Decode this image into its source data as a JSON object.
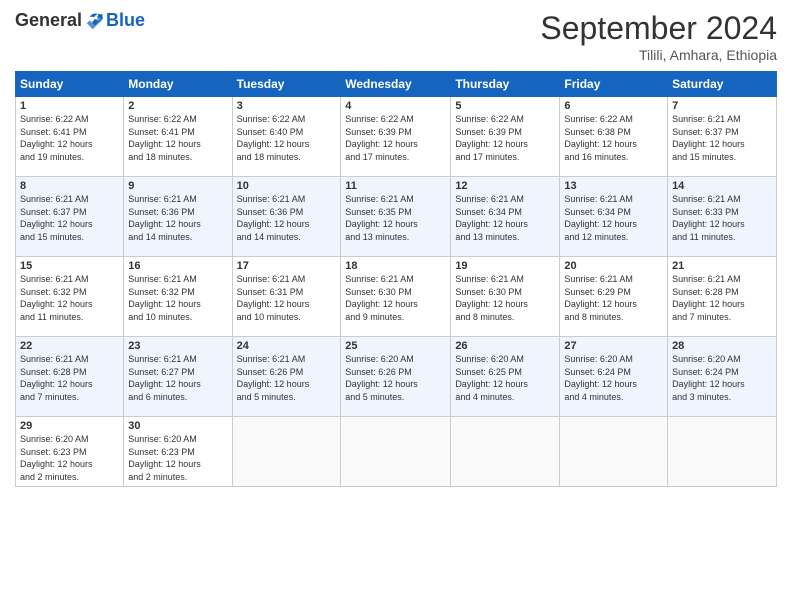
{
  "logo": {
    "general": "General",
    "blue": "Blue"
  },
  "header": {
    "month": "September 2024",
    "location": "Tilili, Amhara, Ethiopia"
  },
  "days_of_week": [
    "Sunday",
    "Monday",
    "Tuesday",
    "Wednesday",
    "Thursday",
    "Friday",
    "Saturday"
  ],
  "weeks": [
    [
      {
        "day": "1",
        "sunrise": "6:22 AM",
        "sunset": "6:41 PM",
        "daylight": "12 hours and 19 minutes."
      },
      {
        "day": "2",
        "sunrise": "6:22 AM",
        "sunset": "6:41 PM",
        "daylight": "12 hours and 18 minutes."
      },
      {
        "day": "3",
        "sunrise": "6:22 AM",
        "sunset": "6:40 PM",
        "daylight": "12 hours and 18 minutes."
      },
      {
        "day": "4",
        "sunrise": "6:22 AM",
        "sunset": "6:39 PM",
        "daylight": "12 hours and 17 minutes."
      },
      {
        "day": "5",
        "sunrise": "6:22 AM",
        "sunset": "6:39 PM",
        "daylight": "12 hours and 17 minutes."
      },
      {
        "day": "6",
        "sunrise": "6:22 AM",
        "sunset": "6:38 PM",
        "daylight": "12 hours and 16 minutes."
      },
      {
        "day": "7",
        "sunrise": "6:21 AM",
        "sunset": "6:37 PM",
        "daylight": "12 hours and 15 minutes."
      }
    ],
    [
      {
        "day": "8",
        "sunrise": "6:21 AM",
        "sunset": "6:37 PM",
        "daylight": "12 hours and 15 minutes."
      },
      {
        "day": "9",
        "sunrise": "6:21 AM",
        "sunset": "6:36 PM",
        "daylight": "12 hours and 14 minutes."
      },
      {
        "day": "10",
        "sunrise": "6:21 AM",
        "sunset": "6:36 PM",
        "daylight": "12 hours and 14 minutes."
      },
      {
        "day": "11",
        "sunrise": "6:21 AM",
        "sunset": "6:35 PM",
        "daylight": "12 hours and 13 minutes."
      },
      {
        "day": "12",
        "sunrise": "6:21 AM",
        "sunset": "6:34 PM",
        "daylight": "12 hours and 13 minutes."
      },
      {
        "day": "13",
        "sunrise": "6:21 AM",
        "sunset": "6:34 PM",
        "daylight": "12 hours and 12 minutes."
      },
      {
        "day": "14",
        "sunrise": "6:21 AM",
        "sunset": "6:33 PM",
        "daylight": "12 hours and 11 minutes."
      }
    ],
    [
      {
        "day": "15",
        "sunrise": "6:21 AM",
        "sunset": "6:32 PM",
        "daylight": "12 hours and 11 minutes."
      },
      {
        "day": "16",
        "sunrise": "6:21 AM",
        "sunset": "6:32 PM",
        "daylight": "12 hours and 10 minutes."
      },
      {
        "day": "17",
        "sunrise": "6:21 AM",
        "sunset": "6:31 PM",
        "daylight": "12 hours and 10 minutes."
      },
      {
        "day": "18",
        "sunrise": "6:21 AM",
        "sunset": "6:30 PM",
        "daylight": "12 hours and 9 minutes."
      },
      {
        "day": "19",
        "sunrise": "6:21 AM",
        "sunset": "6:30 PM",
        "daylight": "12 hours and 8 minutes."
      },
      {
        "day": "20",
        "sunrise": "6:21 AM",
        "sunset": "6:29 PM",
        "daylight": "12 hours and 8 minutes."
      },
      {
        "day": "21",
        "sunrise": "6:21 AM",
        "sunset": "6:28 PM",
        "daylight": "12 hours and 7 minutes."
      }
    ],
    [
      {
        "day": "22",
        "sunrise": "6:21 AM",
        "sunset": "6:28 PM",
        "daylight": "12 hours and 7 minutes."
      },
      {
        "day": "23",
        "sunrise": "6:21 AM",
        "sunset": "6:27 PM",
        "daylight": "12 hours and 6 minutes."
      },
      {
        "day": "24",
        "sunrise": "6:21 AM",
        "sunset": "6:26 PM",
        "daylight": "12 hours and 5 minutes."
      },
      {
        "day": "25",
        "sunrise": "6:20 AM",
        "sunset": "6:26 PM",
        "daylight": "12 hours and 5 minutes."
      },
      {
        "day": "26",
        "sunrise": "6:20 AM",
        "sunset": "6:25 PM",
        "daylight": "12 hours and 4 minutes."
      },
      {
        "day": "27",
        "sunrise": "6:20 AM",
        "sunset": "6:24 PM",
        "daylight": "12 hours and 4 minutes."
      },
      {
        "day": "28",
        "sunrise": "6:20 AM",
        "sunset": "6:24 PM",
        "daylight": "12 hours and 3 minutes."
      }
    ],
    [
      {
        "day": "29",
        "sunrise": "6:20 AM",
        "sunset": "6:23 PM",
        "daylight": "12 hours and 2 minutes."
      },
      {
        "day": "30",
        "sunrise": "6:20 AM",
        "sunset": "6:23 PM",
        "daylight": "12 hours and 2 minutes."
      },
      null,
      null,
      null,
      null,
      null
    ]
  ]
}
